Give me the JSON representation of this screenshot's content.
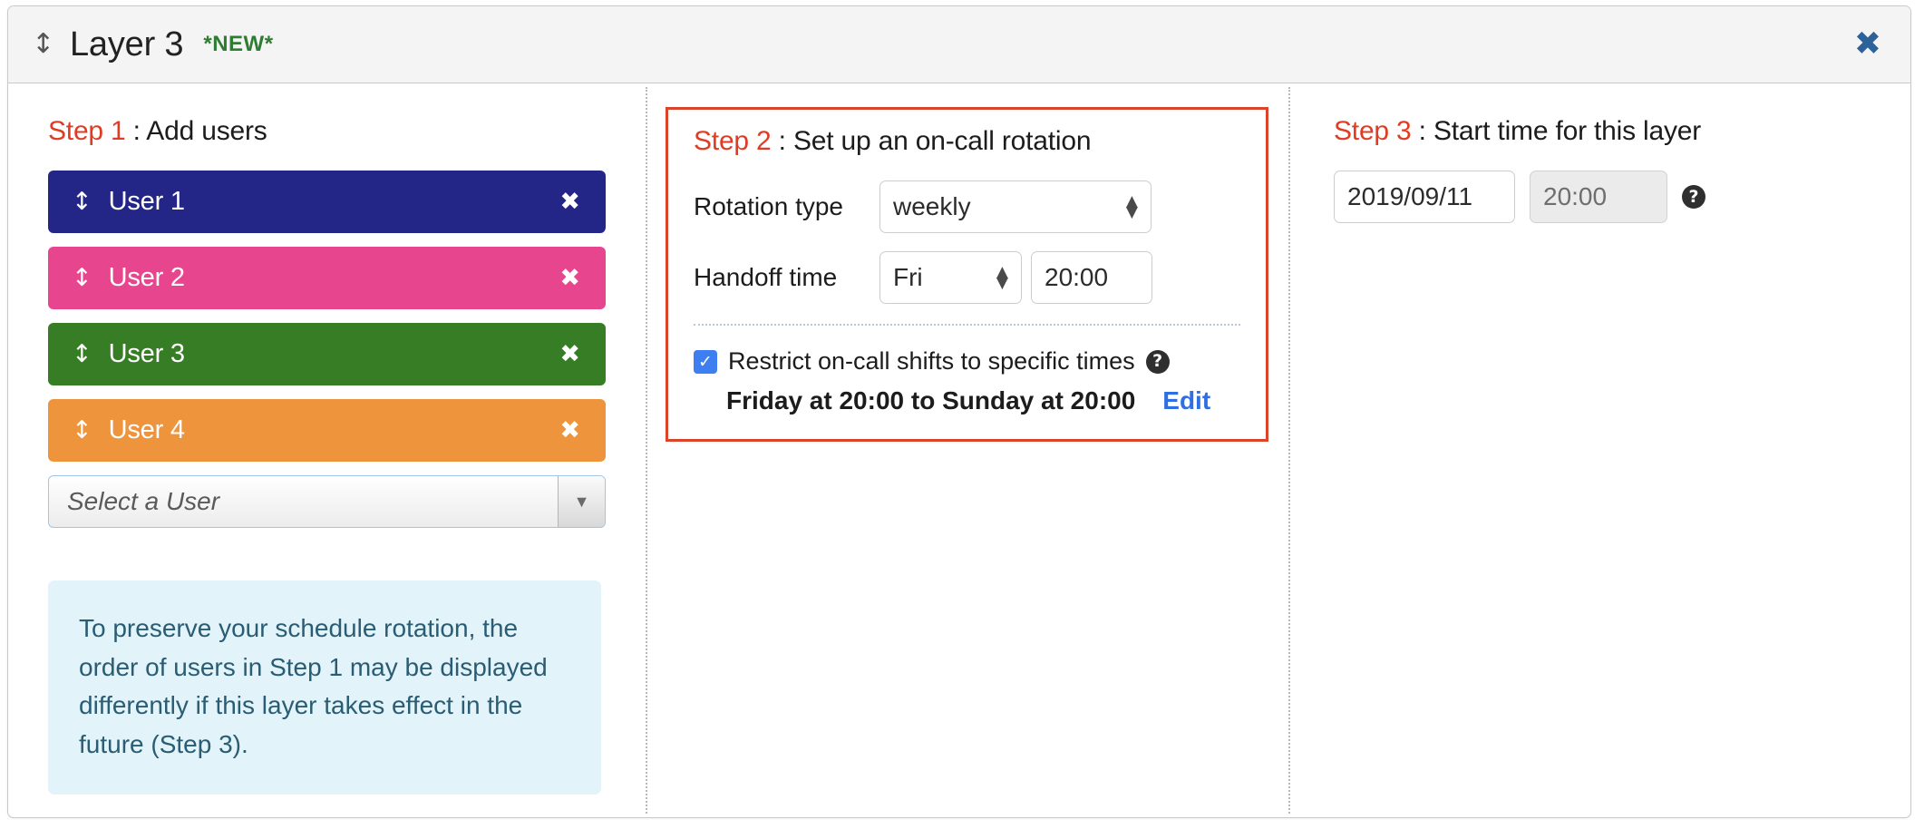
{
  "header": {
    "drag_handle_icon": "drag-vertical-icon",
    "title": "Layer 3",
    "badge": "*NEW*",
    "close_icon": "✖",
    "close_label": "Close"
  },
  "step1": {
    "step_label": "Step 1",
    "separator": " : ",
    "title": "Add users",
    "users": [
      {
        "name": "User 1",
        "color": "#232687",
        "handle_icon": "↕",
        "remove_icon": "✖"
      },
      {
        "name": "User 2",
        "color": "#e8458f",
        "handle_icon": "↕",
        "remove_icon": "✖"
      },
      {
        "name": "User 3",
        "color": "#367d26",
        "handle_icon": "↕",
        "remove_icon": "✖"
      },
      {
        "name": "User 4",
        "color": "#ed943c",
        "handle_icon": "↕",
        "remove_icon": "✖"
      }
    ],
    "select_user": {
      "placeholder": "Select a User",
      "arrow_icon": "▼"
    },
    "info_text": "To preserve your schedule rotation, the order of users in Step 1 may be displayed differently if this layer takes effect in the future (Step 3)."
  },
  "step2": {
    "step_label": "Step 2",
    "separator": " : ",
    "title": "Set up an on-call rotation",
    "border_color": "#d9442a",
    "rotation_type": {
      "label": "Rotation type",
      "value": "weekly",
      "stepper_up": "▲",
      "stepper_down": "▼"
    },
    "handoff_time": {
      "label": "Handoff time",
      "day_value": "Fri",
      "time_value": "20:00",
      "stepper_up": "▲",
      "stepper_down": "▼"
    },
    "restrict": {
      "checked": true,
      "check_icon": "✓",
      "label": "Restrict on-call shifts to specific times",
      "help_icon": "?",
      "range": "Friday at 20:00 to Sunday at 20:00",
      "edit_label": "Edit"
    }
  },
  "step3": {
    "step_label": "Step 3",
    "separator": " : ",
    "title": "Start time for this layer",
    "date_value": "2019/09/11",
    "time_value": "20:00",
    "time_disabled": true,
    "help_icon": "?"
  }
}
